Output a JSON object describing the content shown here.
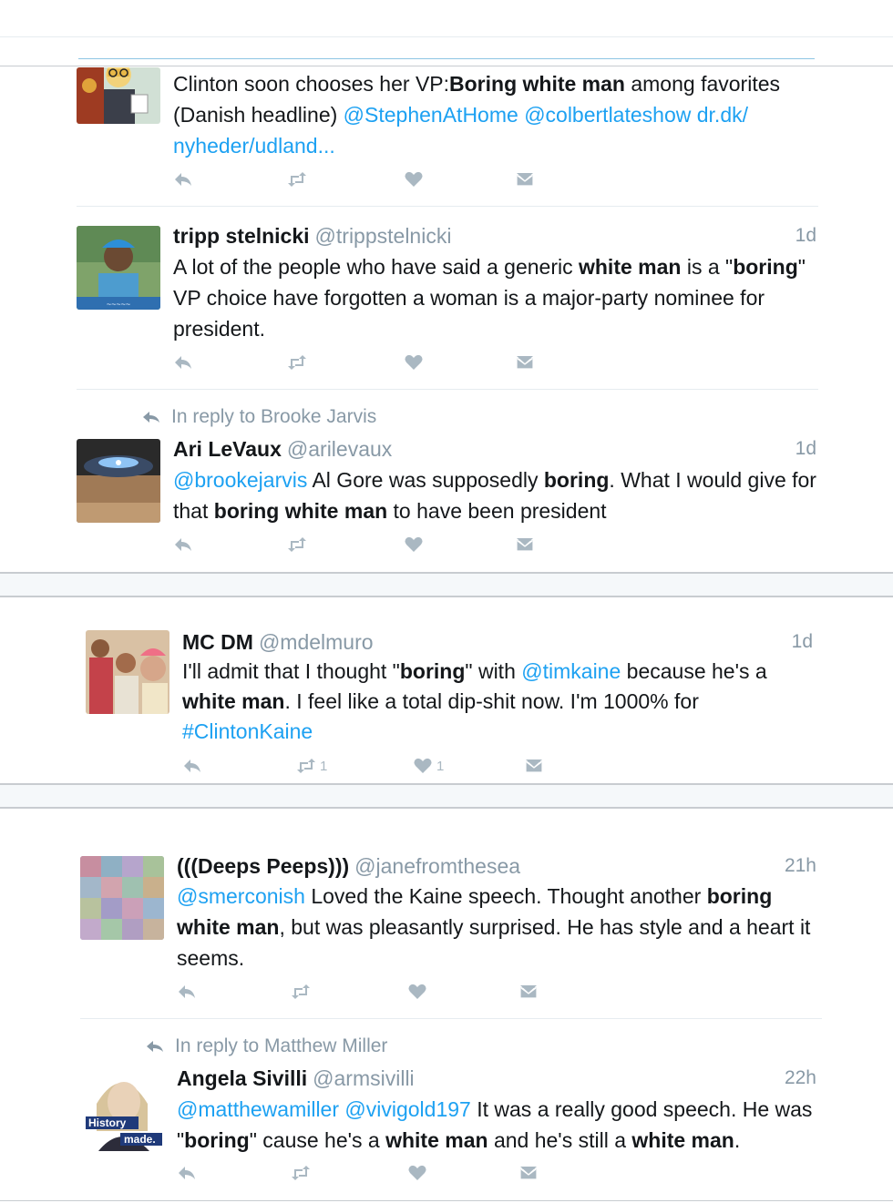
{
  "tweets": [
    {
      "text": [
        {
          "t": "Clinton soon chooses her VP:"
        },
        {
          "t": "Boring white man",
          "b": true
        },
        {
          "t": " among favorites (Danish headline) "
        },
        {
          "t": "@StephenAtHome",
          "l": true
        },
        {
          "t": " "
        },
        {
          "t": "@colbertlateshow",
          "l": true
        },
        {
          "t": " "
        },
        {
          "t": "dr.dk/ nyheder/udland...",
          "l": true
        }
      ],
      "avatar": "cartoon-clinton-avatar"
    },
    {
      "name": "tripp stelnicki",
      "handle": "@trippstelnicki",
      "time": "1d",
      "text": [
        {
          "t": "A lot of the people who have said a generic "
        },
        {
          "t": "white man",
          "b": true
        },
        {
          "t": " is a \""
        },
        {
          "t": "boring",
          "b": true
        },
        {
          "t": "\" VP choice have forgotten a woman is a major-party nominee for president."
        }
      ],
      "avatar": "person-cap-avatar"
    },
    {
      "reply_to": "In reply to Brooke Jarvis",
      "name": "Ari LeVaux",
      "handle": "@arilevaux",
      "time": "1d",
      "text": [
        {
          "t": "@brookejarvis",
          "l": true
        },
        {
          "t": " Al Gore was supposedly "
        },
        {
          "t": "boring",
          "b": true
        },
        {
          "t": ". What I would give for that "
        },
        {
          "t": "boring white man",
          "b": true
        },
        {
          "t": " to have been president"
        }
      ],
      "avatar": "storm-photo-avatar"
    },
    {
      "name": "MC DM",
      "handle": "@mdelmuro",
      "time": "1d",
      "text": [
        {
          "t": "I'll admit that I thought \""
        },
        {
          "t": "boring",
          "b": true
        },
        {
          "t": "\" with "
        },
        {
          "t": "@timkaine",
          "l": true
        },
        {
          "t": " because he's a "
        },
        {
          "t": "white man",
          "b": true
        },
        {
          "t": ". I feel like a total dip-shit now. I'm 1000% for "
        },
        {
          "t": "#ClintonKaine",
          "l": true
        }
      ],
      "retweets": "1",
      "likes": "1",
      "avatar": "group-selfie-avatar"
    },
    {
      "name": "(((Deeps Peeps)))",
      "handle": "@janefromthesea",
      "time": "21h",
      "text": [
        {
          "t": "@smerconish",
          "l": true
        },
        {
          "t": " Loved the Kaine speech. Thought another "
        },
        {
          "t": "boring white man",
          "b": true
        },
        {
          "t": ", but was pleasantly surprised. He has style and a heart it seems."
        }
      ],
      "avatar": "quilt-pattern-avatar"
    },
    {
      "reply_to": "In reply to Matthew Miller",
      "name": "Angela Sivilli",
      "handle": "@armsivilli",
      "time": "22h",
      "text": [
        {
          "t": "@matthewamiller",
          "l": true
        },
        {
          "t": " "
        },
        {
          "t": "@vivigold197",
          "l": true
        },
        {
          "t": " It was a really good speech. He was \""
        },
        {
          "t": "boring",
          "b": true
        },
        {
          "t": "\" cause he's a "
        },
        {
          "t": "white man",
          "b": true
        },
        {
          "t": " and he's still a "
        },
        {
          "t": "white man",
          "b": true
        },
        {
          "t": "."
        }
      ],
      "avatar": "history-made-avatar",
      "avatar_text": [
        "History",
        "made."
      ]
    }
  ],
  "icons": {
    "reply": "reply-icon",
    "retweet": "retweet-icon",
    "like": "heart-icon",
    "dm": "envelope-icon"
  },
  "colors": {
    "link": "#1da1f2",
    "muted": "#8899a6",
    "icon": "#aab8c2"
  }
}
